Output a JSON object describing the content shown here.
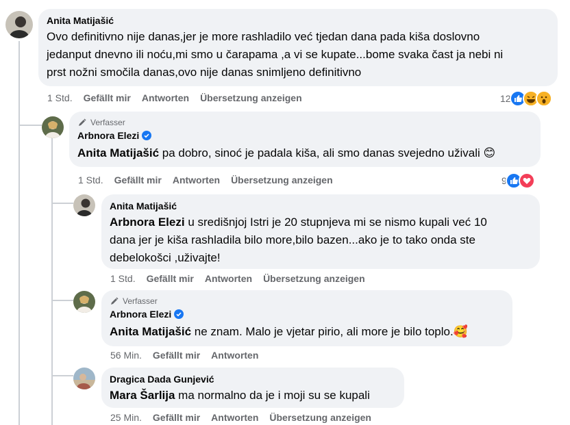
{
  "actions": {
    "time_1": "1 Std.",
    "time_56": "56 Min.",
    "time_25": "25 Min.",
    "like": "Gefällt mir",
    "reply": "Antworten",
    "translate": "Übersetzung anzeigen"
  },
  "author_badge": "Verfasser",
  "comments": [
    {
      "author": "Anita Matijašić",
      "text": "Ovo definitivno nije danas,jer je more rashladilo već tjedan dana pada kiša doslovno",
      "text2": "jedanput dnevno ili noću,mi smo u čarapama ,a vi se kupate...bome svaka čast ja nebi ni",
      "text3": "prst nožni smočila danas,ovo nije danas snimljeno definitivno",
      "reactions": "12",
      "reaction_icons": [
        "like-icon",
        "laugh-icon",
        "wow-icon"
      ]
    },
    {
      "author": "Arbnora Elezi",
      "mention": "Anita Matijašić",
      "text": " pa dobro, sinoć je padala kiša, ali smo danas svejedno uživali 😊",
      "reactions": "9",
      "reaction_icons": [
        "like-icon",
        "love-icon"
      ]
    },
    {
      "author": "Anita Matijašić",
      "mention": "Arbnora Elezi",
      "text": " u središnjoj Istri je 20 stupnjeva mi se nismo kupali već 10",
      "text2": "dana jer je kiša rashladila bilo more,bilo bazen...ako je to tako onda ste",
      "text3": "debelokošci ,uživajte!"
    },
    {
      "author": "Arbnora Elezi",
      "mention": "Anita Matijašić",
      "text": " ne znam. Malo je vjetar pirio, ali more je bilo toplo.🥰"
    },
    {
      "author": "Dragica Dada Gunjević",
      "mention": "Mara Šarlija",
      "text": " ma normalno da je i moji su se kupali"
    }
  ],
  "colors": {
    "bubble": "#f0f2f5",
    "secondary": "#65676b",
    "like": "#1877f2",
    "love": "#f33e58",
    "verified": "#1877f2"
  }
}
